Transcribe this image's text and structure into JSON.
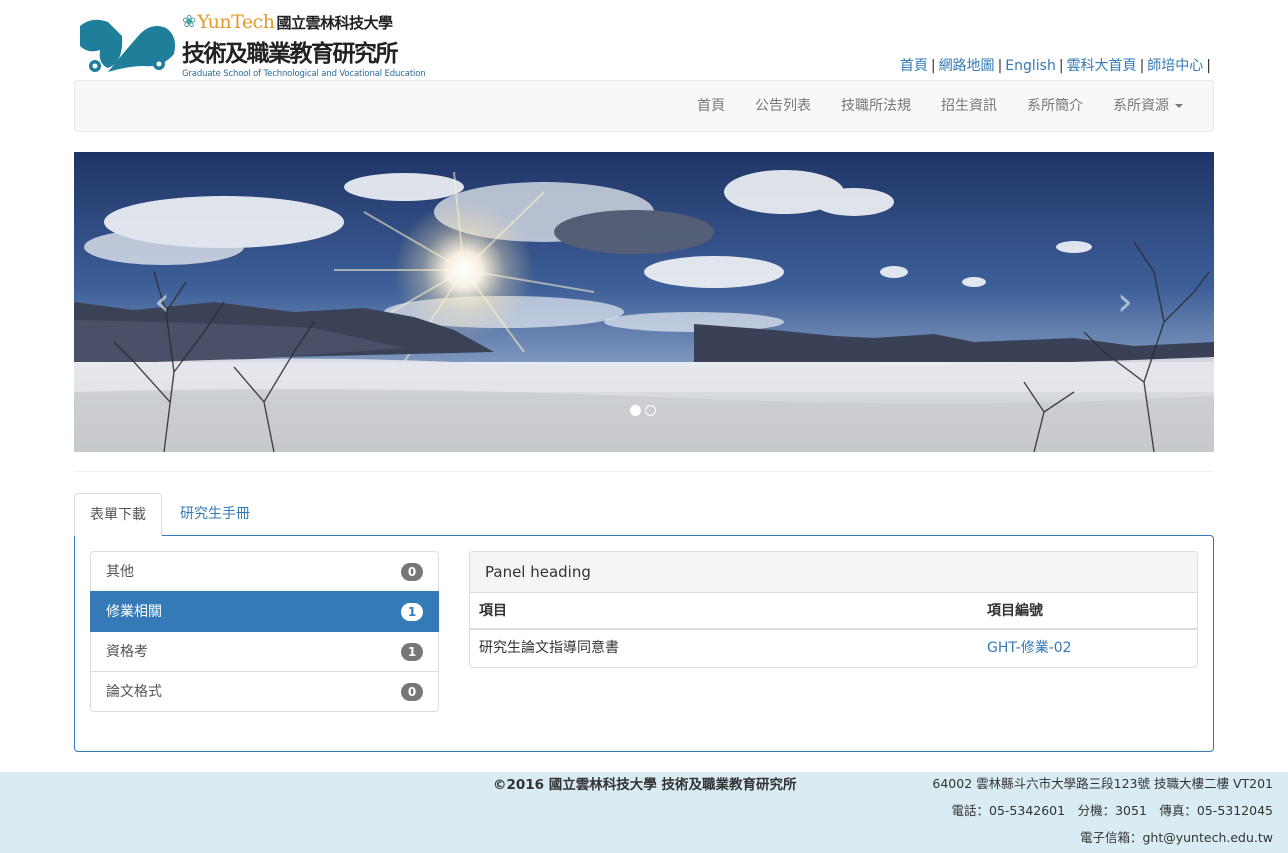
{
  "logo": {
    "yuntech_word": "YunTech",
    "university_cn": "國立雲林科技大學",
    "dept_cn": "技術及職業教育研究所",
    "dept_en": "Graduate School of Technological and Vocational Education"
  },
  "top_links": [
    "首頁",
    "網路地圖",
    "English",
    "雲科大首頁",
    "師培中心"
  ],
  "top_links_separator": "|",
  "nav": {
    "items": [
      "首頁",
      "公告列表",
      "技職所法規",
      "招生資訊",
      "系所簡介"
    ],
    "dropdown_label": "系所資源"
  },
  "carousel": {
    "prev_glyph": "‹",
    "next_glyph": "›",
    "slide_count": 2,
    "active_index": 0
  },
  "tabs": {
    "active": "表單下載",
    "other": "研究生手冊"
  },
  "categories": [
    {
      "label": "其他",
      "count": "0",
      "active": false
    },
    {
      "label": "修業相關",
      "count": "1",
      "active": true
    },
    {
      "label": "資格考",
      "count": "1",
      "active": false
    },
    {
      "label": "論文格式",
      "count": "0",
      "active": false
    }
  ],
  "panel": {
    "heading": "Panel heading",
    "columns": [
      "項目",
      "項目編號"
    ],
    "rows": [
      {
        "item": "研究生論文指導同意書",
        "code": "GHT-修業-02"
      }
    ]
  },
  "footer": {
    "copyright": "©2016 國立雲林科技大學 技術及職業教育研究所",
    "address": "64002 雲林縣斗六市大學路三段123號 技職大樓二樓 VT201",
    "phone": "電話：05-5342601　分機：3051　傳真：05-5312045",
    "email": "電子信箱：ght@yuntech.edu.tw"
  },
  "colors": {
    "link": "#337ab7",
    "tab_border": "#337ab7",
    "footer_bg": "#d9ecf3",
    "logo_teal": "#1f7f9b",
    "logo_orange": "#e39a2c"
  }
}
